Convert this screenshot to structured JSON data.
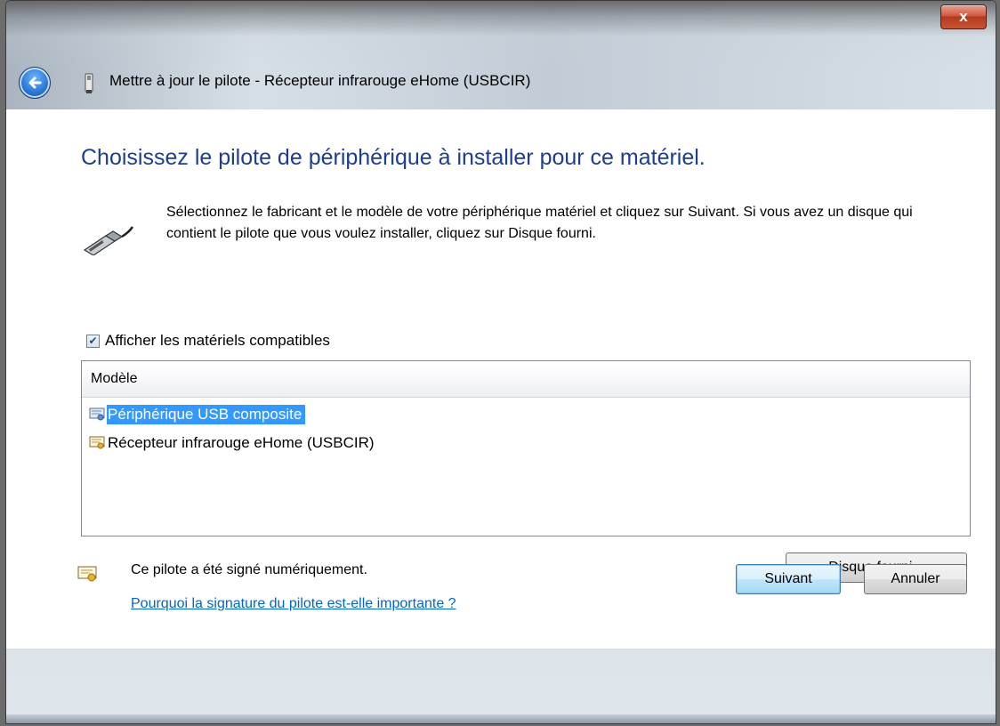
{
  "window": {
    "title": "Mettre à jour le pilote - Récepteur infrarouge eHome (USBCIR)",
    "close_label": "x"
  },
  "main": {
    "heading": "Choisissez le pilote de périphérique à installer pour ce matériel.",
    "description": "Sélectionnez le fabricant et le modèle de votre périphérique matériel et cliquez sur Suivant. Si vous avez un disque qui contient le pilote que vous voulez installer, cliquez sur Disque fourni.",
    "show_compatible_label": "Afficher les matériels compatibles",
    "show_compatible_checked": true
  },
  "list": {
    "header": "Modèle",
    "items": [
      {
        "label": "Périphérique USB composite",
        "selected": true
      },
      {
        "label": "Récepteur infrarouge eHome (USBCIR)",
        "selected": false
      }
    ]
  },
  "signature": {
    "status_text": "Ce pilote a été signé numériquement.",
    "link_text": "Pourquoi la signature du pilote est-elle importante ?"
  },
  "buttons": {
    "have_disk": "Disque fourni...",
    "next": "Suivant",
    "cancel": "Annuler"
  },
  "colors": {
    "heading": "#1e3d8f",
    "selection": "#3399ff",
    "link": "#0066cc"
  },
  "icons": {
    "back": "back-arrow-icon",
    "title": "usb-device-icon",
    "usb": "usb-cable-icon",
    "certificate": "certificate-icon"
  }
}
